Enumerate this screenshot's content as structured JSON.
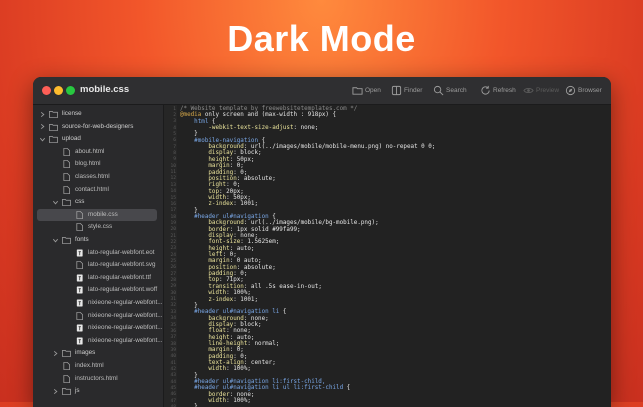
{
  "headline": "Dark Mode",
  "window": {
    "title": "mobile.css",
    "toolbar": [
      {
        "label": "Open",
        "icon": "folder-icon",
        "disabled": false
      },
      {
        "label": "Finder",
        "icon": "finder-icon",
        "disabled": false
      },
      {
        "label": "Search",
        "icon": "search-icon",
        "disabled": false
      },
      {
        "label": "Refresh",
        "icon": "refresh-icon",
        "disabled": false
      },
      {
        "label": "Preview",
        "icon": "eye-icon",
        "disabled": true
      },
      {
        "label": "Browser",
        "icon": "compass-icon",
        "disabled": false
      }
    ]
  },
  "sidebar": {
    "items": [
      {
        "label": "license",
        "type": "folder",
        "depth": 0,
        "expanded": false
      },
      {
        "label": "source-for-web-designers",
        "type": "folder",
        "depth": 0,
        "expanded": false
      },
      {
        "label": "upload",
        "type": "folder",
        "depth": 0,
        "expanded": true
      },
      {
        "label": "about.html",
        "type": "file",
        "depth": 1
      },
      {
        "label": "blog.html",
        "type": "file",
        "depth": 1
      },
      {
        "label": "classes.html",
        "type": "file",
        "depth": 1
      },
      {
        "label": "contact.html",
        "type": "file",
        "depth": 1
      },
      {
        "label": "css",
        "type": "folder",
        "depth": 1,
        "expanded": true
      },
      {
        "label": "mobile.css",
        "type": "file",
        "depth": 2,
        "selected": true
      },
      {
        "label": "style.css",
        "type": "file",
        "depth": 2
      },
      {
        "label": "fonts",
        "type": "folder",
        "depth": 1,
        "expanded": true
      },
      {
        "label": "lato-regular-webfont.eot",
        "type": "font",
        "depth": 2
      },
      {
        "label": "lato-regular-webfont.svg",
        "type": "file",
        "depth": 2
      },
      {
        "label": "lato-regular-webfont.ttf",
        "type": "font",
        "depth": 2
      },
      {
        "label": "lato-regular-webfont.woff",
        "type": "font",
        "depth": 2
      },
      {
        "label": "nixieone-regular-webfont...",
        "type": "font",
        "depth": 2
      },
      {
        "label": "nixieone-regular-webfont...",
        "type": "file",
        "depth": 2
      },
      {
        "label": "nixieone-regular-webfont...",
        "type": "font",
        "depth": 2
      },
      {
        "label": "nixieone-regular-webfont...",
        "type": "font",
        "depth": 2
      },
      {
        "label": "images",
        "type": "folder",
        "depth": 1,
        "expanded": false
      },
      {
        "label": "index.html",
        "type": "file",
        "depth": 1
      },
      {
        "label": "instructors.html",
        "type": "file",
        "depth": 1
      },
      {
        "label": "js",
        "type": "folder",
        "depth": 1,
        "expanded": false
      }
    ]
  },
  "editor": {
    "lines": [
      [
        [
          "c-com",
          "/* Website template by freewebsitetemplates.com */"
        ]
      ],
      [
        [
          "c-at",
          "@media"
        ],
        [
          "c-val",
          " only screen and (max-width : 918px) {"
        ]
      ],
      [
        [
          "c-sel",
          "    html"
        ],
        [
          "c-val",
          " {"
        ]
      ],
      [
        [
          "c-prop",
          "        -webkit-text-size-adjust"
        ],
        [
          "c-val",
          ": none;"
        ]
      ],
      [
        [
          "c-val",
          "    }"
        ]
      ],
      [
        [
          "c-sel",
          "    #mobile-navigation"
        ],
        [
          "c-val",
          " {"
        ]
      ],
      [
        [
          "c-prop",
          "        background"
        ],
        [
          "c-val",
          ": url(../images/mobile/mobile-menu.png) no-repeat 0 0;"
        ]
      ],
      [
        [
          "c-prop",
          "        display"
        ],
        [
          "c-val",
          ": block;"
        ]
      ],
      [
        [
          "c-prop",
          "        height"
        ],
        [
          "c-val",
          ": 50px;"
        ]
      ],
      [
        [
          "c-prop",
          "        margin"
        ],
        [
          "c-val",
          ": 0;"
        ]
      ],
      [
        [
          "c-prop",
          "        padding"
        ],
        [
          "c-val",
          ": 0;"
        ]
      ],
      [
        [
          "c-prop",
          "        position"
        ],
        [
          "c-val",
          ": absolute;"
        ]
      ],
      [
        [
          "c-prop",
          "        right"
        ],
        [
          "c-val",
          ": 0;"
        ]
      ],
      [
        [
          "c-prop",
          "        top"
        ],
        [
          "c-val",
          ": 20px;"
        ]
      ],
      [
        [
          "c-prop",
          "        width"
        ],
        [
          "c-val",
          ": 50px;"
        ]
      ],
      [
        [
          "c-prop",
          "        z-index"
        ],
        [
          "c-val",
          ": 1001;"
        ]
      ],
      [
        [
          "c-val",
          "    }"
        ]
      ],
      [
        [
          "c-sel",
          "    #header ul#navigation"
        ],
        [
          "c-val",
          " {"
        ]
      ],
      [
        [
          "c-prop",
          "        background"
        ],
        [
          "c-val",
          ": url(../images/mobile/bg-mobile.png);"
        ]
      ],
      [
        [
          "c-prop",
          "        border"
        ],
        [
          "c-val",
          ": 1px solid #99fa99;"
        ]
      ],
      [
        [
          "c-prop",
          "        display"
        ],
        [
          "c-val",
          ": none;"
        ]
      ],
      [
        [
          "c-prop",
          "        font-size"
        ],
        [
          "c-val",
          ": 1.5625em;"
        ]
      ],
      [
        [
          "c-prop",
          "        height"
        ],
        [
          "c-val",
          ": auto;"
        ]
      ],
      [
        [
          "c-prop",
          "        left"
        ],
        [
          "c-val",
          ": 0;"
        ]
      ],
      [
        [
          "c-prop",
          "        margin"
        ],
        [
          "c-val",
          ": 0 auto;"
        ]
      ],
      [
        [
          "c-prop",
          "        position"
        ],
        [
          "c-val",
          ": absolute;"
        ]
      ],
      [
        [
          "c-prop",
          "        padding"
        ],
        [
          "c-val",
          ": 0;"
        ]
      ],
      [
        [
          "c-prop",
          "        top"
        ],
        [
          "c-val",
          ": 71px;"
        ]
      ],
      [
        [
          "c-prop",
          "        transition"
        ],
        [
          "c-val",
          ": all .5s ease-in-out;"
        ]
      ],
      [
        [
          "c-prop",
          "        width"
        ],
        [
          "c-val",
          ": 100%;"
        ]
      ],
      [
        [
          "c-prop",
          "        z-index"
        ],
        [
          "c-val",
          ": 1001;"
        ]
      ],
      [
        [
          "c-val",
          "    }"
        ]
      ],
      [
        [
          "c-sel",
          "    #header ul#navigation li"
        ],
        [
          "c-val",
          " {"
        ]
      ],
      [
        [
          "c-prop",
          "        background"
        ],
        [
          "c-val",
          ": none;"
        ]
      ],
      [
        [
          "c-prop",
          "        display"
        ],
        [
          "c-val",
          ": block;"
        ]
      ],
      [
        [
          "c-prop",
          "        float"
        ],
        [
          "c-val",
          ": none;"
        ]
      ],
      [
        [
          "c-prop",
          "        height"
        ],
        [
          "c-val",
          ": auto;"
        ]
      ],
      [
        [
          "c-prop",
          "        line-height"
        ],
        [
          "c-val",
          ": normal;"
        ]
      ],
      [
        [
          "c-prop",
          "        margin"
        ],
        [
          "c-val",
          ": 0;"
        ]
      ],
      [
        [
          "c-prop",
          "        padding"
        ],
        [
          "c-val",
          ": 0;"
        ]
      ],
      [
        [
          "c-prop",
          "        text-align"
        ],
        [
          "c-val",
          ": center;"
        ]
      ],
      [
        [
          "c-prop",
          "        width"
        ],
        [
          "c-val",
          ": 100%;"
        ]
      ],
      [
        [
          "c-val",
          "    }"
        ]
      ],
      [
        [
          "c-sel",
          "    #header ul#navigation li:first-child,"
        ]
      ],
      [
        [
          "c-sel",
          "    #header ul#navigation li ul li:first-child"
        ],
        [
          "c-val",
          " {"
        ]
      ],
      [
        [
          "c-prop",
          "        border"
        ],
        [
          "c-val",
          ": none;"
        ]
      ],
      [
        [
          "c-prop",
          "        width"
        ],
        [
          "c-val",
          ": 100%;"
        ]
      ],
      [
        [
          "c-val",
          "    }"
        ]
      ]
    ]
  }
}
